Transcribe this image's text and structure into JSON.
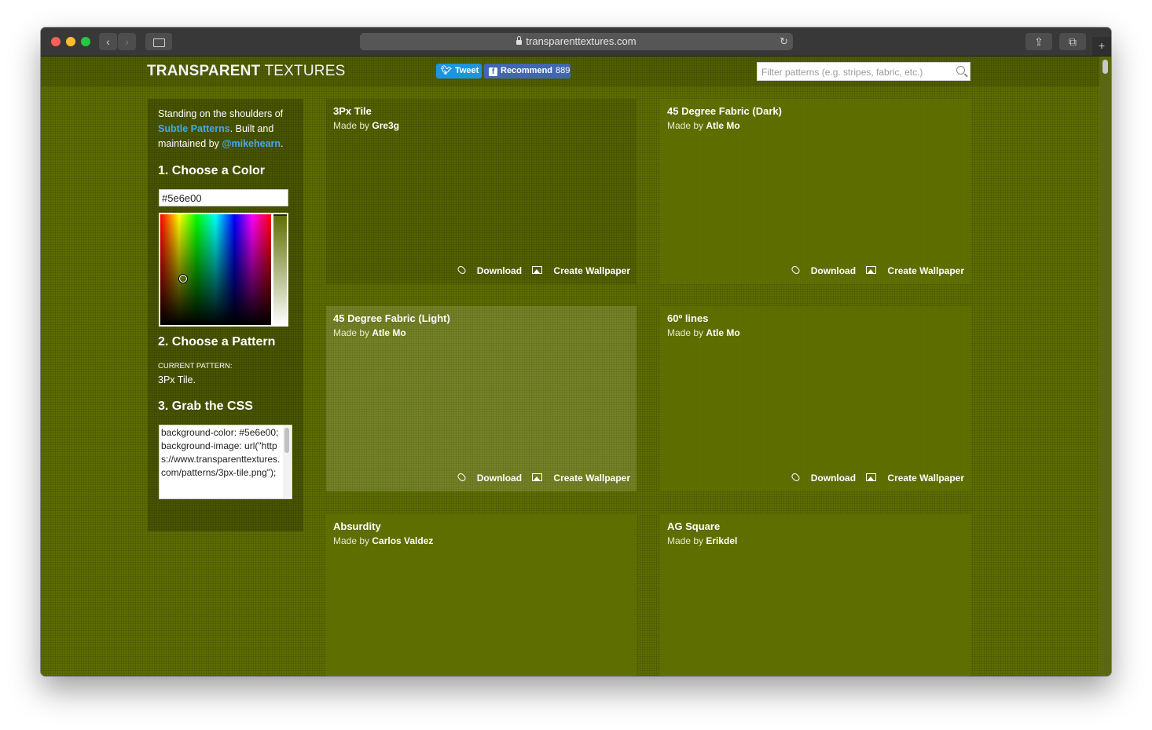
{
  "browser": {
    "url": "transparenttextures.com",
    "back_glyph": "‹",
    "forward_glyph": "›",
    "reload_glyph": "↻",
    "share_glyph": "⇪",
    "tabs_glyph": "⧉",
    "new_tab_glyph": "+"
  },
  "header": {
    "logo_bold": "TRANSPARENT",
    "logo_thin": "TEXTURES",
    "tweet_label": "Tweet",
    "recommend_label": "Recommend",
    "recommend_count": "889",
    "search_placeholder": "Filter patterns (e.g. stripes, fabric, etc.)"
  },
  "sidebar": {
    "intro_prefix": "Standing on the shoulders of ",
    "intro_link1": "Subtle Patterns",
    "intro_middle": ". Built and maintained by ",
    "intro_link2": "@mikehearn",
    "intro_suffix": ".",
    "step1": "1. Choose a Color",
    "color_value": "#5e6e00",
    "step2": "2. Choose a Pattern",
    "current_label": "CURRENT PATTERN:",
    "current_value": "3Px Tile.",
    "step3": "3. Grab the CSS",
    "css_text": "background-color: #5e6e00; background-image: url(\"https://www.transparenttextures.com/patterns/3px-tile.png\");"
  },
  "cards": [
    {
      "title": "3Px Tile",
      "made_by": "Made by ",
      "author": "Gre3g",
      "download": "Download",
      "wallpaper": "Create Wallpaper"
    },
    {
      "title": "45 Degree Fabric (Dark)",
      "made_by": "Made by ",
      "author": "Atle Mo",
      "download": "Download",
      "wallpaper": "Create Wallpaper"
    },
    {
      "title": "45 Degree Fabric (Light)",
      "made_by": "Made by ",
      "author": "Atle Mo",
      "download": "Download",
      "wallpaper": "Create Wallpaper"
    },
    {
      "title": "60º lines",
      "made_by": "Made by ",
      "author": "Atle Mo",
      "download": "Download",
      "wallpaper": "Create Wallpaper"
    },
    {
      "title": "Absurdity",
      "made_by": "Made by ",
      "author": "Carlos Valdez"
    },
    {
      "title": "AG Square",
      "made_by": "Made by ",
      "author": "Erikdel"
    }
  ],
  "colors": {
    "background": "#5e6e00",
    "link": "#3fa9f5",
    "tweet": "#1b95e0",
    "facebook": "#4267b2"
  }
}
